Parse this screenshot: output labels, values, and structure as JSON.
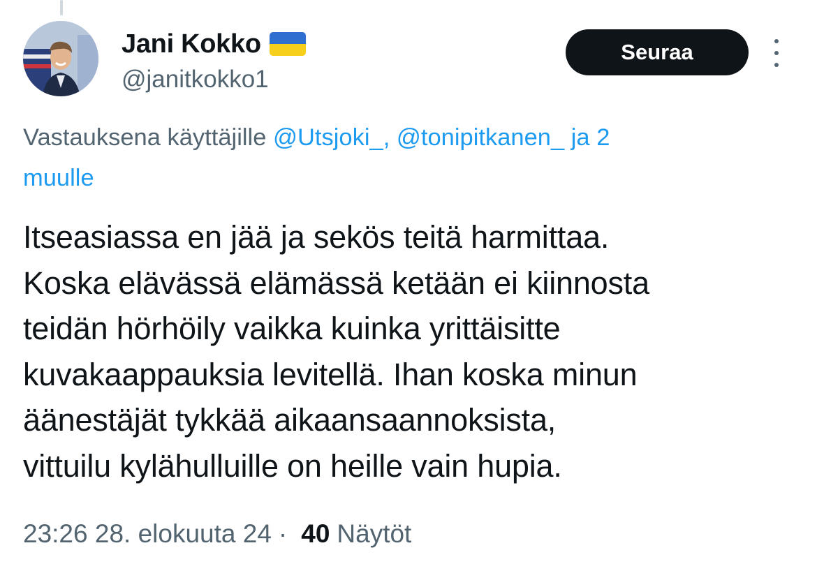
{
  "author": {
    "display_name": "Jani Kokko",
    "handle": "@janitkokko1",
    "flag_icon": "ukraine-flag-emoji"
  },
  "follow_label": "Seuraa",
  "reply_context": {
    "prefix": "Vastauksena käyttäjille ",
    "mention_1": "@Utsjoki_",
    "separator": ", ",
    "mention_2": "@tonipitkanen_",
    "suffix_line1": " ja 2",
    "suffix_line2": "muulle"
  },
  "tweet_lines": [
    "Itseasiassa en jää ja sekös teitä harmittaa.",
    "Koska elävässä elämässä ketään ei kiinnosta",
    "teidän hörhöily vaikka kuinka yrittäisitte",
    "kuvakaappauksia levitellä. Ihan koska minun",
    "äänestäjät tykkää aikaansaannoksista,",
    "vittuilu kylähulluille on heille vain hupia."
  ],
  "meta": {
    "timestamp": "23:26 28. elokuuta 24",
    "dot": "·",
    "views_count": "40",
    "views_label": "Näytöt"
  },
  "colors": {
    "text": "#0f1419",
    "secondary": "#536471",
    "link": "#1d9bf0",
    "button": "#0f1419"
  }
}
